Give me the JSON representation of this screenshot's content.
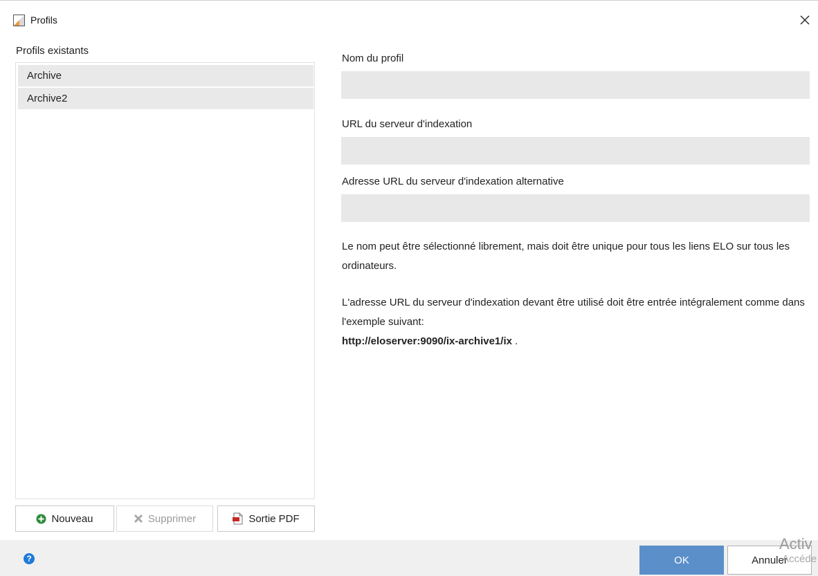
{
  "window": {
    "title": "Profils",
    "title_icon": "elo-profile-icon",
    "close_icon": "close-icon"
  },
  "left_panel": {
    "label": "Profils existants",
    "profiles": [
      {
        "label": "Archive"
      },
      {
        "label": "Archive2"
      }
    ],
    "buttons": {
      "new": {
        "label": "Nouveau",
        "icon": "plus-circle-icon",
        "icon_color": "#2e8b3a"
      },
      "delete": {
        "label": "Supprimer",
        "icon": "x-icon",
        "disabled": true
      },
      "pdf": {
        "label": "Sortie PDF",
        "icon": "pdf-icon",
        "icon_color": "#c62828"
      }
    }
  },
  "form": {
    "profile_name": {
      "label": "Nom du profil",
      "value": ""
    },
    "index_server_url": {
      "label": "URL du serveur d'indexation",
      "value": ""
    },
    "alt_index_server_url": {
      "label": "Adresse URL du serveur d'indexation alternative",
      "value": ""
    }
  },
  "info": {
    "paragraph1": "Le nom peut être sélectionné librement, mais doit être unique pour tous les liens ELO sur tous les ordinateurs.",
    "paragraph2": "L'adresse URL du serveur d'indexation devant être utilisé doit être entrée intégralement comme dans l'exemple suivant:",
    "example_url": "http://eloserver:9090/ix-archive1/ix",
    "example_suffix": " ."
  },
  "footer": {
    "help_icon": "help-icon",
    "help_glyph": "?",
    "ok_label": "OK",
    "cancel_label": "Annuler"
  },
  "watermark": {
    "line1": "Activ",
    "line2": "Accéde"
  },
  "colors": {
    "accent": "#5b8fc9",
    "field_bg": "#e8e8e8",
    "list_item_bg": "#e9e9e9",
    "footer_bg": "#f0f0f0"
  }
}
